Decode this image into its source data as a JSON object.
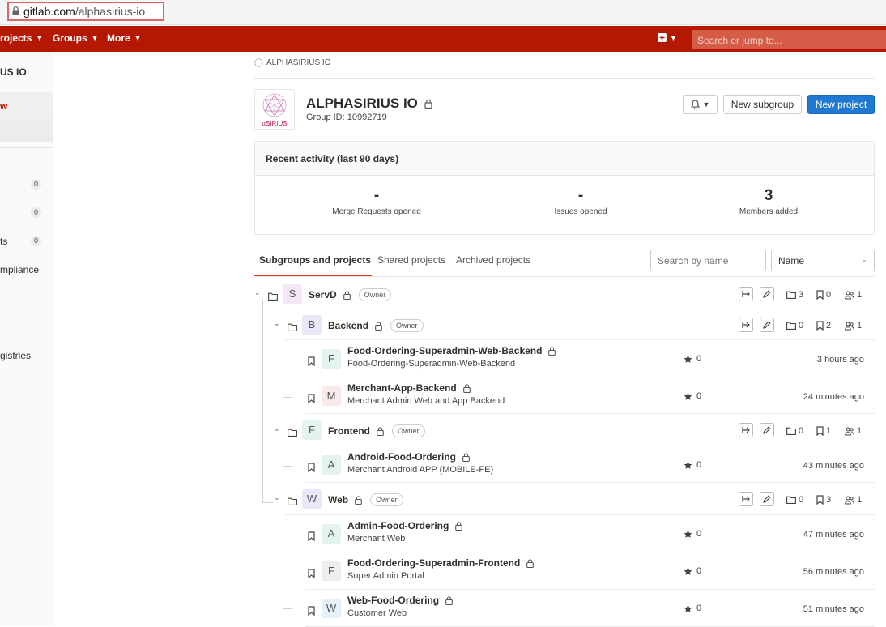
{
  "browser": {
    "url_domain": "gitlab.com",
    "url_path": "/alphasirius-io"
  },
  "topnav": {
    "projects_label": "rojects",
    "groups_label": "Groups",
    "more_label": "More",
    "search_placeholder": "Search or jump to..."
  },
  "sidebar": {
    "group_name": "US IO",
    "overview_label": "w",
    "items": [
      {
        "label": "",
        "badge": "0"
      },
      {
        "label": "",
        "badge": "0"
      },
      {
        "label": "ts",
        "badge": "0"
      },
      {
        "label": "mpliance"
      },
      {
        "label": "gistries"
      }
    ]
  },
  "breadcrumb": {
    "label": "ALPHASIRIUS IO"
  },
  "group": {
    "title": "ALPHASIRIUS IO",
    "id_text": "Group ID: 10992719",
    "logo_text": "αSIRIUS"
  },
  "buttons": {
    "new_subgroup": "New subgroup",
    "new_project": "New project"
  },
  "activity": {
    "title": "Recent activity (last 90 days)",
    "stats": [
      {
        "value": "-",
        "label": "Merge Requests opened"
      },
      {
        "value": "-",
        "label": "Issues opened"
      },
      {
        "value": "3",
        "label": "Members added"
      }
    ]
  },
  "tabs": [
    "Subgroups and projects",
    "Shared projects",
    "Archived projects"
  ],
  "search": {
    "placeholder": "Search by name",
    "sort": "Name"
  },
  "rows": [
    {
      "kind": "group",
      "level": 0,
      "letter": "S",
      "name": "ServD",
      "badge": "Owner",
      "subgroups": "3",
      "projects": "0",
      "members": "1",
      "color": "#f4e7f8"
    },
    {
      "kind": "group",
      "level": 1,
      "letter": "B",
      "name": "Backend",
      "badge": "Owner",
      "subgroups": "0",
      "projects": "2",
      "members": "1",
      "color": "#e8e8fa"
    },
    {
      "kind": "project",
      "level": 2,
      "letter": "F",
      "name": "Food-Ordering-Superadmin-Web-Backend",
      "desc": "Food-Ordering-Superadmin-Web-Backend",
      "stars": "0",
      "updated": "3 hours ago",
      "color": "#e3f4ef"
    },
    {
      "kind": "project",
      "level": 2,
      "letter": "M",
      "name": "Merchant-App-Backend",
      "desc": "Merchant Admin Web and App Backend",
      "stars": "0",
      "updated": "24 minutes ago",
      "color": "#fbe8ea"
    },
    {
      "kind": "group",
      "level": 1,
      "letter": "F",
      "name": "Frontend",
      "badge": "Owner",
      "subgroups": "0",
      "projects": "1",
      "members": "1",
      "color": "#e3f4ef"
    },
    {
      "kind": "project",
      "level": 2,
      "letter": "A",
      "name": "Android-Food-Ordering",
      "desc": "Merchant Android APP (MOBILE-FE)",
      "stars": "0",
      "updated": "43 minutes ago",
      "color": "#e3f4ef"
    },
    {
      "kind": "group",
      "level": 1,
      "letter": "W",
      "name": "Web",
      "badge": "Owner",
      "subgroups": "0",
      "projects": "3",
      "members": "1",
      "color": "#e8e8fa"
    },
    {
      "kind": "project",
      "level": 2,
      "letter": "A",
      "name": "Admin-Food-Ordering",
      "desc": "Merchant Web",
      "stars": "0",
      "updated": "47 minutes ago",
      "color": "#e3f4ef"
    },
    {
      "kind": "project",
      "level": 2,
      "letter": "F",
      "name": "Food-Ordering-Superadmin-Frontend",
      "desc": "Super Admin Portal",
      "stars": "0",
      "updated": "56 minutes ago",
      "color": "#eeeeee"
    },
    {
      "kind": "project",
      "level": 2,
      "letter": "W",
      "name": "Web-Food-Ordering",
      "desc": "Customer Web",
      "stars": "0",
      "updated": "51 minutes ago",
      "color": "#e6f0fa"
    }
  ]
}
